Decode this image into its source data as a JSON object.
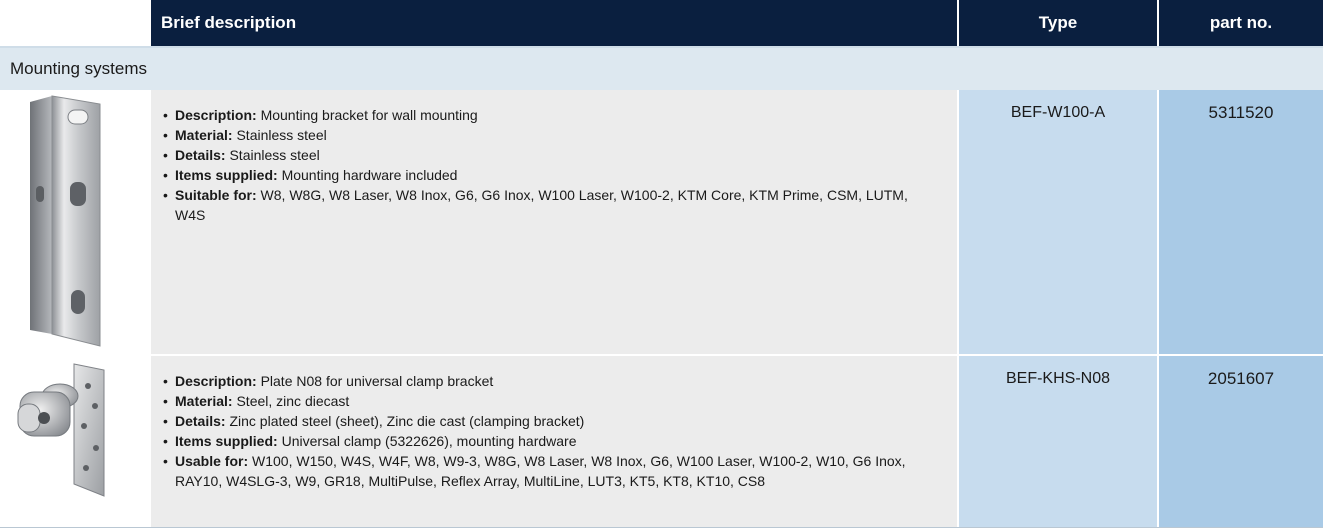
{
  "header": {
    "brief_description": "Brief description",
    "type": "Type",
    "part_no": "part no."
  },
  "section": {
    "title": "Mounting systems"
  },
  "products": [
    {
      "image": "stainless-steel-wall-bracket",
      "items": [
        {
          "key": "Description:",
          "value": " Mounting bracket for wall mounting"
        },
        {
          "key": "Material:",
          "value": " Stainless steel"
        },
        {
          "key": "Details:",
          "value": " Stainless steel"
        },
        {
          "key": "Items supplied:",
          "value": " Mounting hardware included"
        },
        {
          "key": "Suitable for:",
          "value": " W8, W8G, W8 Laser, W8 Inox, G6, G6 Inox, W100 Laser, W100-2, KTM Core, KTM Prime, CSM, LUTM, W4S"
        }
      ],
      "type": "BEF-W100-A",
      "part_no": "5311520"
    },
    {
      "image": "universal-clamp-plate",
      "items": [
        {
          "key": "Description:",
          "value": " Plate N08 for universal clamp bracket"
        },
        {
          "key": "Material:",
          "value": " Steel, zinc diecast"
        },
        {
          "key": "Details:",
          "value": " Zinc plated steel (sheet), Zinc die cast (clamping bracket)"
        },
        {
          "key": "Items supplied:",
          "value": " Universal clamp (5322626), mounting hardware"
        },
        {
          "key": "Usable for:",
          "value": " W100, W150, W4S, W4F, W8, W9-3, W8G, W8 Laser, W8 Inox, G6, W100 Laser, W100-2, W10, G6 Inox, RAY10, W4SLG-3, W9, GR18, MultiPulse, Reflex Array, MultiLine, LUT3, KT5, KT8, KT10, CS8"
        }
      ],
      "type": "BEF-KHS-N08",
      "part_no": "2051607"
    }
  ],
  "colors": {
    "header_bg": "#0a1f3f",
    "section_bg": "#dde8f0",
    "desc_bg": "#ececec",
    "type_bg": "#c7dcee",
    "part_bg": "#a9cae6"
  }
}
